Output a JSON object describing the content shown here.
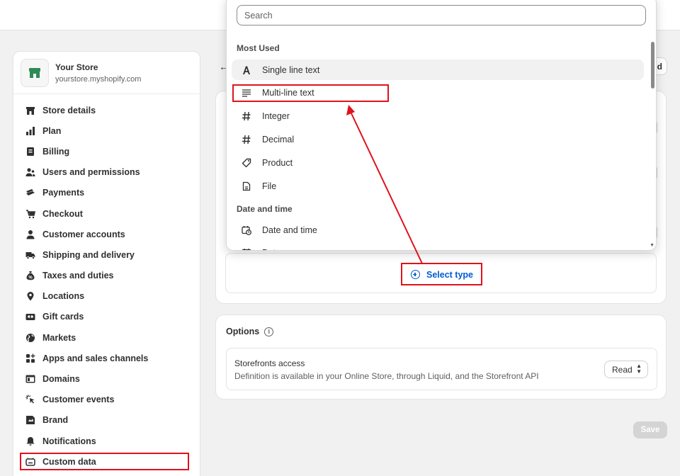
{
  "store": {
    "name": "Your Store",
    "url": "yourstore.myshopify.com"
  },
  "sidebar": {
    "items": [
      {
        "label": "Store details",
        "icon": "store-icon"
      },
      {
        "label": "Plan",
        "icon": "plan-icon"
      },
      {
        "label": "Billing",
        "icon": "billing-icon"
      },
      {
        "label": "Users and permissions",
        "icon": "users-icon"
      },
      {
        "label": "Payments",
        "icon": "payments-icon"
      },
      {
        "label": "Checkout",
        "icon": "cart-icon"
      },
      {
        "label": "Customer accounts",
        "icon": "person-icon"
      },
      {
        "label": "Shipping and delivery",
        "icon": "truck-icon"
      },
      {
        "label": "Taxes and duties",
        "icon": "tax-icon"
      },
      {
        "label": "Locations",
        "icon": "location-icon"
      },
      {
        "label": "Gift cards",
        "icon": "gift-card-icon"
      },
      {
        "label": "Markets",
        "icon": "globe-icon"
      },
      {
        "label": "Apps and sales channels",
        "icon": "apps-icon"
      },
      {
        "label": "Domains",
        "icon": "domain-icon"
      },
      {
        "label": "Customer events",
        "icon": "cursor-icon"
      },
      {
        "label": "Brand",
        "icon": "brand-icon"
      },
      {
        "label": "Notifications",
        "icon": "bell-icon"
      },
      {
        "label": "Custom data",
        "icon": "custom-data-icon"
      }
    ],
    "active_index": 17
  },
  "header": {
    "right_button_stub": "d"
  },
  "main": {
    "select_type_label": "Select type",
    "options": {
      "title": "Options",
      "storefront_title": "Storefronts access",
      "storefront_desc": "Definition is available in your Online Store, through Liquid, and the Storefront API",
      "access_value": "Read"
    },
    "save_label": "Save"
  },
  "dropdown": {
    "search_placeholder": "Search",
    "section1": "Most Used",
    "items1": [
      {
        "label": "Single line text",
        "icon": "text-a-icon"
      },
      {
        "label": "Multi-line text",
        "icon": "multiline-icon"
      },
      {
        "label": "Integer",
        "icon": "hash-icon"
      },
      {
        "label": "Decimal",
        "icon": "hash-icon"
      },
      {
        "label": "Product",
        "icon": "tag-icon"
      },
      {
        "label": "File",
        "icon": "file-icon"
      }
    ],
    "section2": "Date and time",
    "items2": [
      {
        "label": "Date and time",
        "icon": "calendar-clock-icon"
      },
      {
        "label": "Date",
        "icon": "calendar-icon"
      }
    ]
  },
  "colors": {
    "annotation": "#e0121b",
    "link": "#005bd3",
    "store_green": "#2e8b57"
  }
}
